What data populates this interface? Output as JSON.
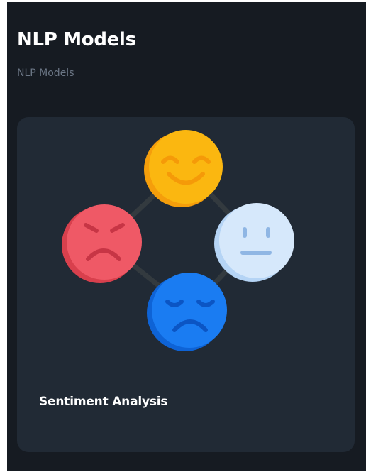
{
  "header": {
    "title": "NLP Models",
    "breadcrumb": "NLP Models"
  },
  "cards": [
    {
      "title": "Sentiment Analysis",
      "illustration_icons": [
        "happy-face-icon",
        "neutral-face-icon",
        "sad-face-icon",
        "angry-face-icon"
      ]
    }
  ],
  "colors": {
    "background": "#161b22",
    "card_background": "#212a35",
    "title_text": "#ffffff",
    "subtitle_text": "#6b7685",
    "happy": "#fbb710",
    "neutral": "#d6e8fb",
    "sad": "#1a7cf2",
    "angry": "#ef5966"
  }
}
